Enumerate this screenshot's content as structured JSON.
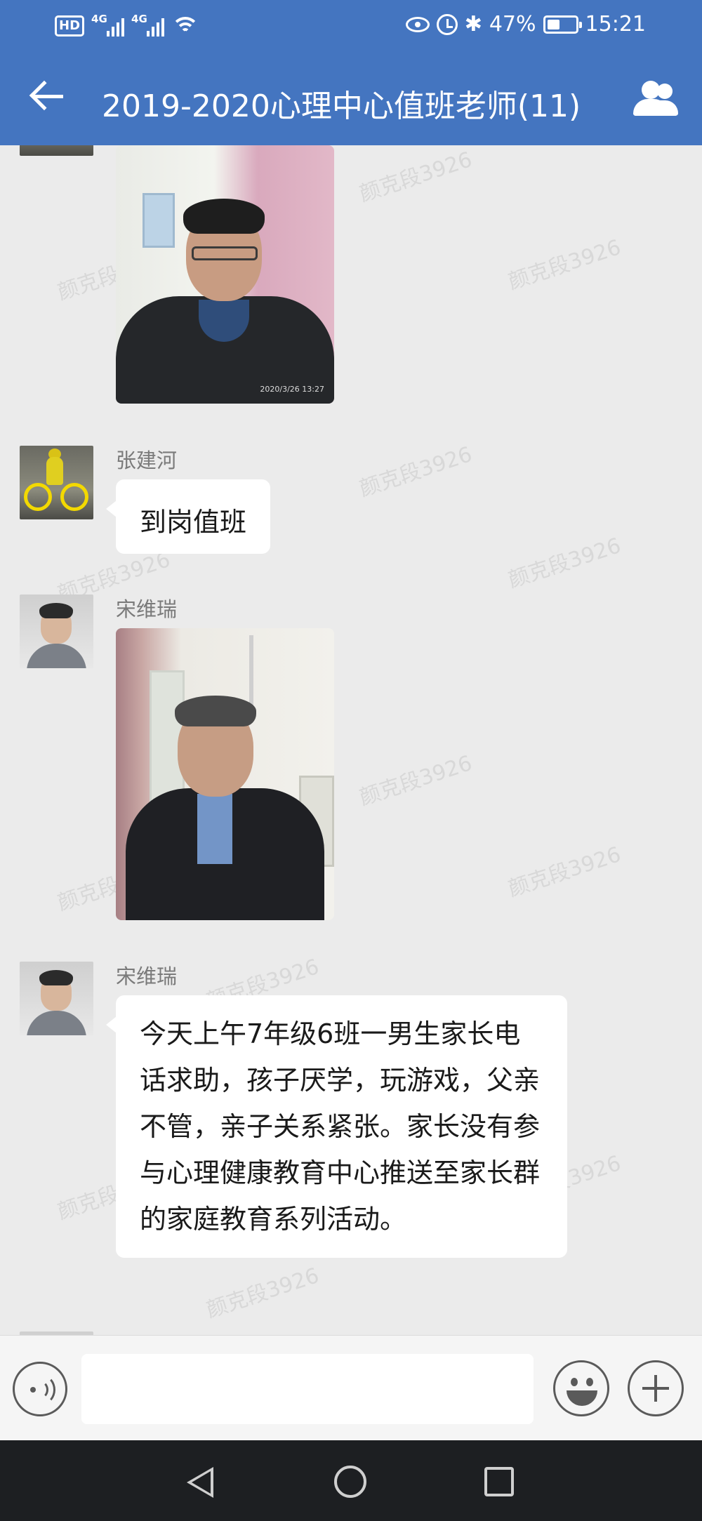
{
  "status_bar": {
    "network_label": "4G",
    "network_label_2": "4G",
    "hd_label": "HD",
    "battery_percent": "47%",
    "battery_level": 0.47,
    "time": "15:21"
  },
  "header": {
    "title": "2019-2020心理中心值班老师(11)"
  },
  "watermark": "颜克段3926",
  "messages": [
    {
      "sender": "",
      "type": "image",
      "photo_timestamp": "2020/3/26 13:27"
    },
    {
      "sender": "张建河",
      "type": "text",
      "text": "到岗值班"
    },
    {
      "sender": "宋维瑞",
      "type": "image"
    },
    {
      "sender": "宋维瑞",
      "type": "text",
      "text": "今天上午7年级6班一男生家长电话求助，孩子厌学，玩游戏，父亲不管，亲子关系紧张。家长没有参与心理健康教育中心推送至家长群的家庭教育系列活动。"
    }
  ],
  "input_bar": {
    "voice_icon": "voice-icon",
    "emoji_icon": "emoji-icon",
    "plus_icon": "plus-icon",
    "text_value": ""
  },
  "nav": {
    "back_icon": "triangle-back-icon",
    "home_icon": "circle-home-icon",
    "recent_icon": "square-recents-icon"
  },
  "colors": {
    "header_bg": "#4475c0",
    "chat_bg": "#ebebeb",
    "bubble_bg": "#ffffff",
    "nav_bg": "#1d1f22"
  }
}
